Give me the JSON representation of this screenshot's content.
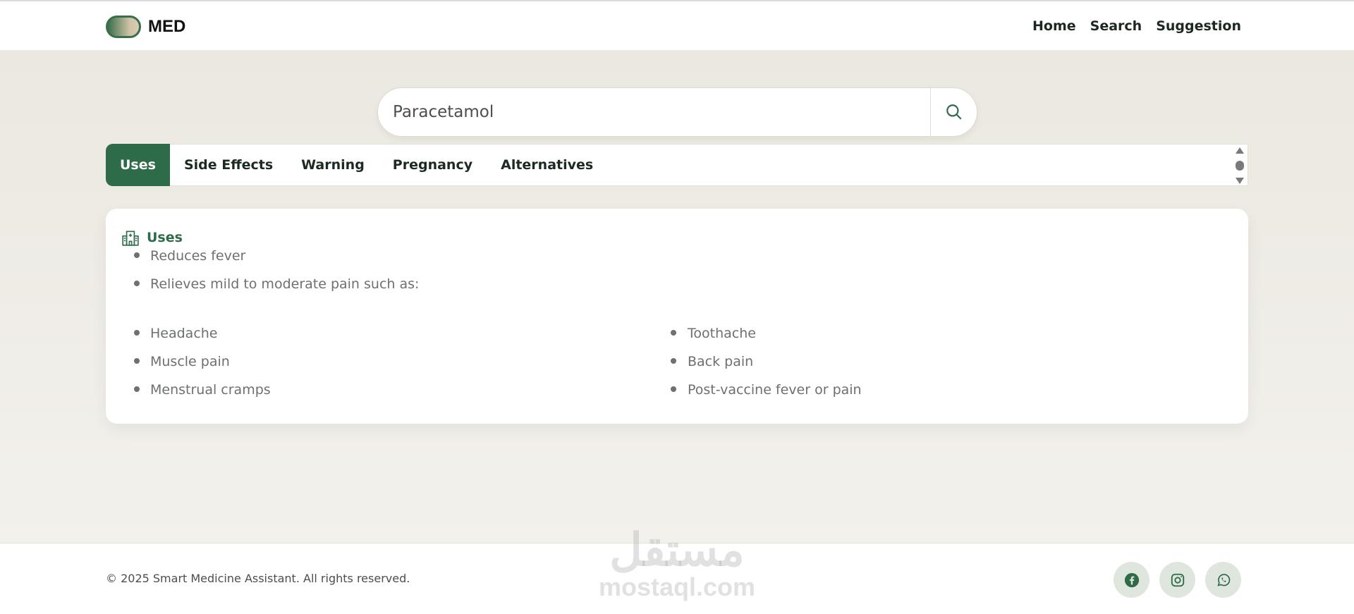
{
  "header": {
    "logo_text": "MED",
    "nav": [
      {
        "label": "Home"
      },
      {
        "label": "Search"
      },
      {
        "label": "Suggestion"
      }
    ]
  },
  "search": {
    "value": "Paracetamol",
    "placeholder": "Paracetamol",
    "button_icon": "search-icon"
  },
  "tabs": [
    {
      "label": "Uses",
      "active": true
    },
    {
      "label": "Side Effects"
    },
    {
      "label": "Warning"
    },
    {
      "label": "Pregnancy"
    },
    {
      "label": "Alternatives"
    }
  ],
  "card": {
    "title": "Uses",
    "icon": "hospital-icon",
    "items": [
      "Reduces fever",
      "Relieves mild to moderate pain such as:"
    ],
    "sub_left": [
      "Headache",
      "Muscle pain",
      "Menstrual cramps"
    ],
    "sub_right": [
      "Toothache",
      "Back pain",
      "Post-vaccine fever or pain"
    ]
  },
  "footer": {
    "copyright": "© 2025 Smart Medicine Assistant. All rights reserved.",
    "socials": [
      "facebook-icon",
      "instagram-icon",
      "whatsapp-icon"
    ]
  },
  "watermark": {
    "arabic": "مستقل",
    "latin": "mostaql.com"
  },
  "colors": {
    "accent": "#2e6b48",
    "background": "#f2f0eb",
    "social_bg": "#dfe6dd"
  }
}
